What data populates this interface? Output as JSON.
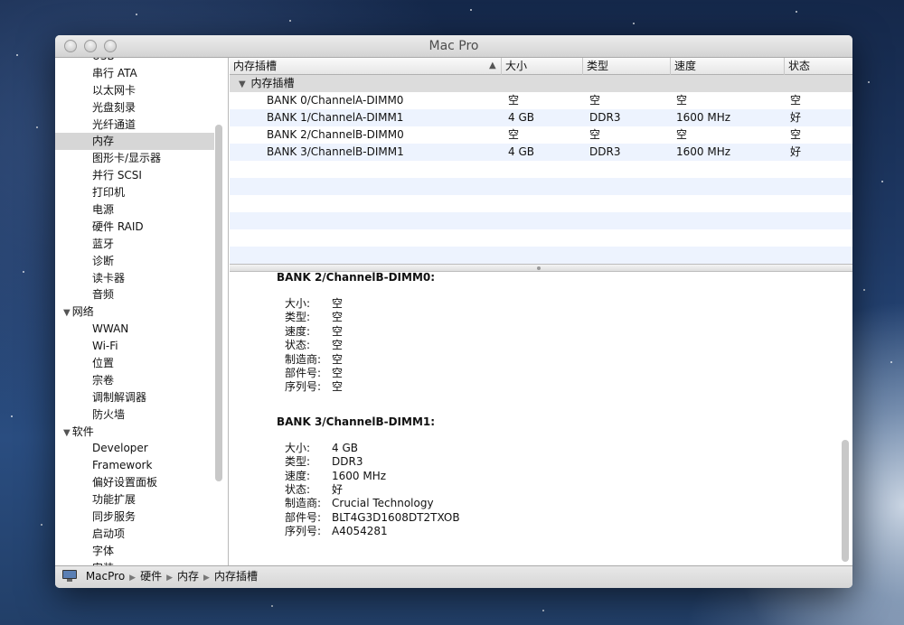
{
  "window": {
    "title": "Mac Pro"
  },
  "sidebar": {
    "items": [
      {
        "label": "USB",
        "type": "item"
      },
      {
        "label": "串行 ATA",
        "type": "item"
      },
      {
        "label": "以太网卡",
        "type": "item"
      },
      {
        "label": "光盘刻录",
        "type": "item"
      },
      {
        "label": "光纤通道",
        "type": "item"
      },
      {
        "label": "内存",
        "type": "item",
        "selected": true
      },
      {
        "label": "图形卡/显示器",
        "type": "item"
      },
      {
        "label": "并行 SCSI",
        "type": "item"
      },
      {
        "label": "打印机",
        "type": "item"
      },
      {
        "label": "电源",
        "type": "item"
      },
      {
        "label": "硬件 RAID",
        "type": "item"
      },
      {
        "label": "蓝牙",
        "type": "item"
      },
      {
        "label": "诊断",
        "type": "item"
      },
      {
        "label": "读卡器",
        "type": "item"
      },
      {
        "label": "音频",
        "type": "item"
      },
      {
        "label": "网络",
        "type": "category"
      },
      {
        "label": "WWAN",
        "type": "item"
      },
      {
        "label": "Wi-Fi",
        "type": "item"
      },
      {
        "label": "位置",
        "type": "item"
      },
      {
        "label": "宗卷",
        "type": "item"
      },
      {
        "label": "调制解调器",
        "type": "item"
      },
      {
        "label": "防火墙",
        "type": "item"
      },
      {
        "label": "软件",
        "type": "category"
      },
      {
        "label": "Developer",
        "type": "item"
      },
      {
        "label": "Framework",
        "type": "item"
      },
      {
        "label": "偏好设置面板",
        "type": "item"
      },
      {
        "label": "功能扩展",
        "type": "item"
      },
      {
        "label": "同步服务",
        "type": "item"
      },
      {
        "label": "启动项",
        "type": "item"
      },
      {
        "label": "字体",
        "type": "item"
      },
      {
        "label": "安装",
        "type": "item"
      }
    ]
  },
  "table": {
    "columns": [
      "内存插槽",
      "大小",
      "类型",
      "速度",
      "状态"
    ],
    "group_label": "内存插槽",
    "rows": [
      [
        "BANK 0/ChannelA-DIMM0",
        "空",
        "空",
        "空",
        "空"
      ],
      [
        "BANK 1/ChannelA-DIMM1",
        "4 GB",
        "DDR3",
        "1600 MHz",
        "好"
      ],
      [
        "BANK 2/ChannelB-DIMM0",
        "空",
        "空",
        "空",
        "空"
      ],
      [
        "BANK 3/ChannelB-DIMM1",
        "4 GB",
        "DDR3",
        "1600 MHz",
        "好"
      ]
    ]
  },
  "detail": {
    "sections": [
      {
        "heading": "BANK 2/ChannelB-DIMM0:",
        "fields": [
          [
            "大小:",
            "空"
          ],
          [
            "类型:",
            "空"
          ],
          [
            "速度:",
            "空"
          ],
          [
            "状态:",
            "空"
          ],
          [
            "制造商:",
            "空"
          ],
          [
            "部件号:",
            "空"
          ],
          [
            "序列号:",
            "空"
          ]
        ]
      },
      {
        "heading": "BANK 3/ChannelB-DIMM1:",
        "fields": [
          [
            "大小:",
            "4 GB"
          ],
          [
            "类型:",
            "DDR3"
          ],
          [
            "速度:",
            "1600 MHz"
          ],
          [
            "状态:",
            "好"
          ],
          [
            "制造商:",
            "Crucial Technology"
          ],
          [
            "部件号:",
            "BLT4G3D1608DT2TXOB"
          ],
          [
            "序列号:",
            "A4054281"
          ]
        ]
      }
    ]
  },
  "pathbar": {
    "crumbs": [
      "MacPro",
      "硬件",
      "内存",
      "内存插槽"
    ]
  },
  "icons": {
    "close": "close-button-icon",
    "minimize": "minimize-button-icon",
    "zoom": "zoom-button-icon",
    "computer": "computer-icon",
    "disclosure": "disclosure-triangle-icon",
    "sort": "sort-ascending-icon"
  },
  "colors": {
    "selection": "#d6d6d6",
    "row_alt": "#edf3fe",
    "group_row": "#dcdcdc"
  }
}
